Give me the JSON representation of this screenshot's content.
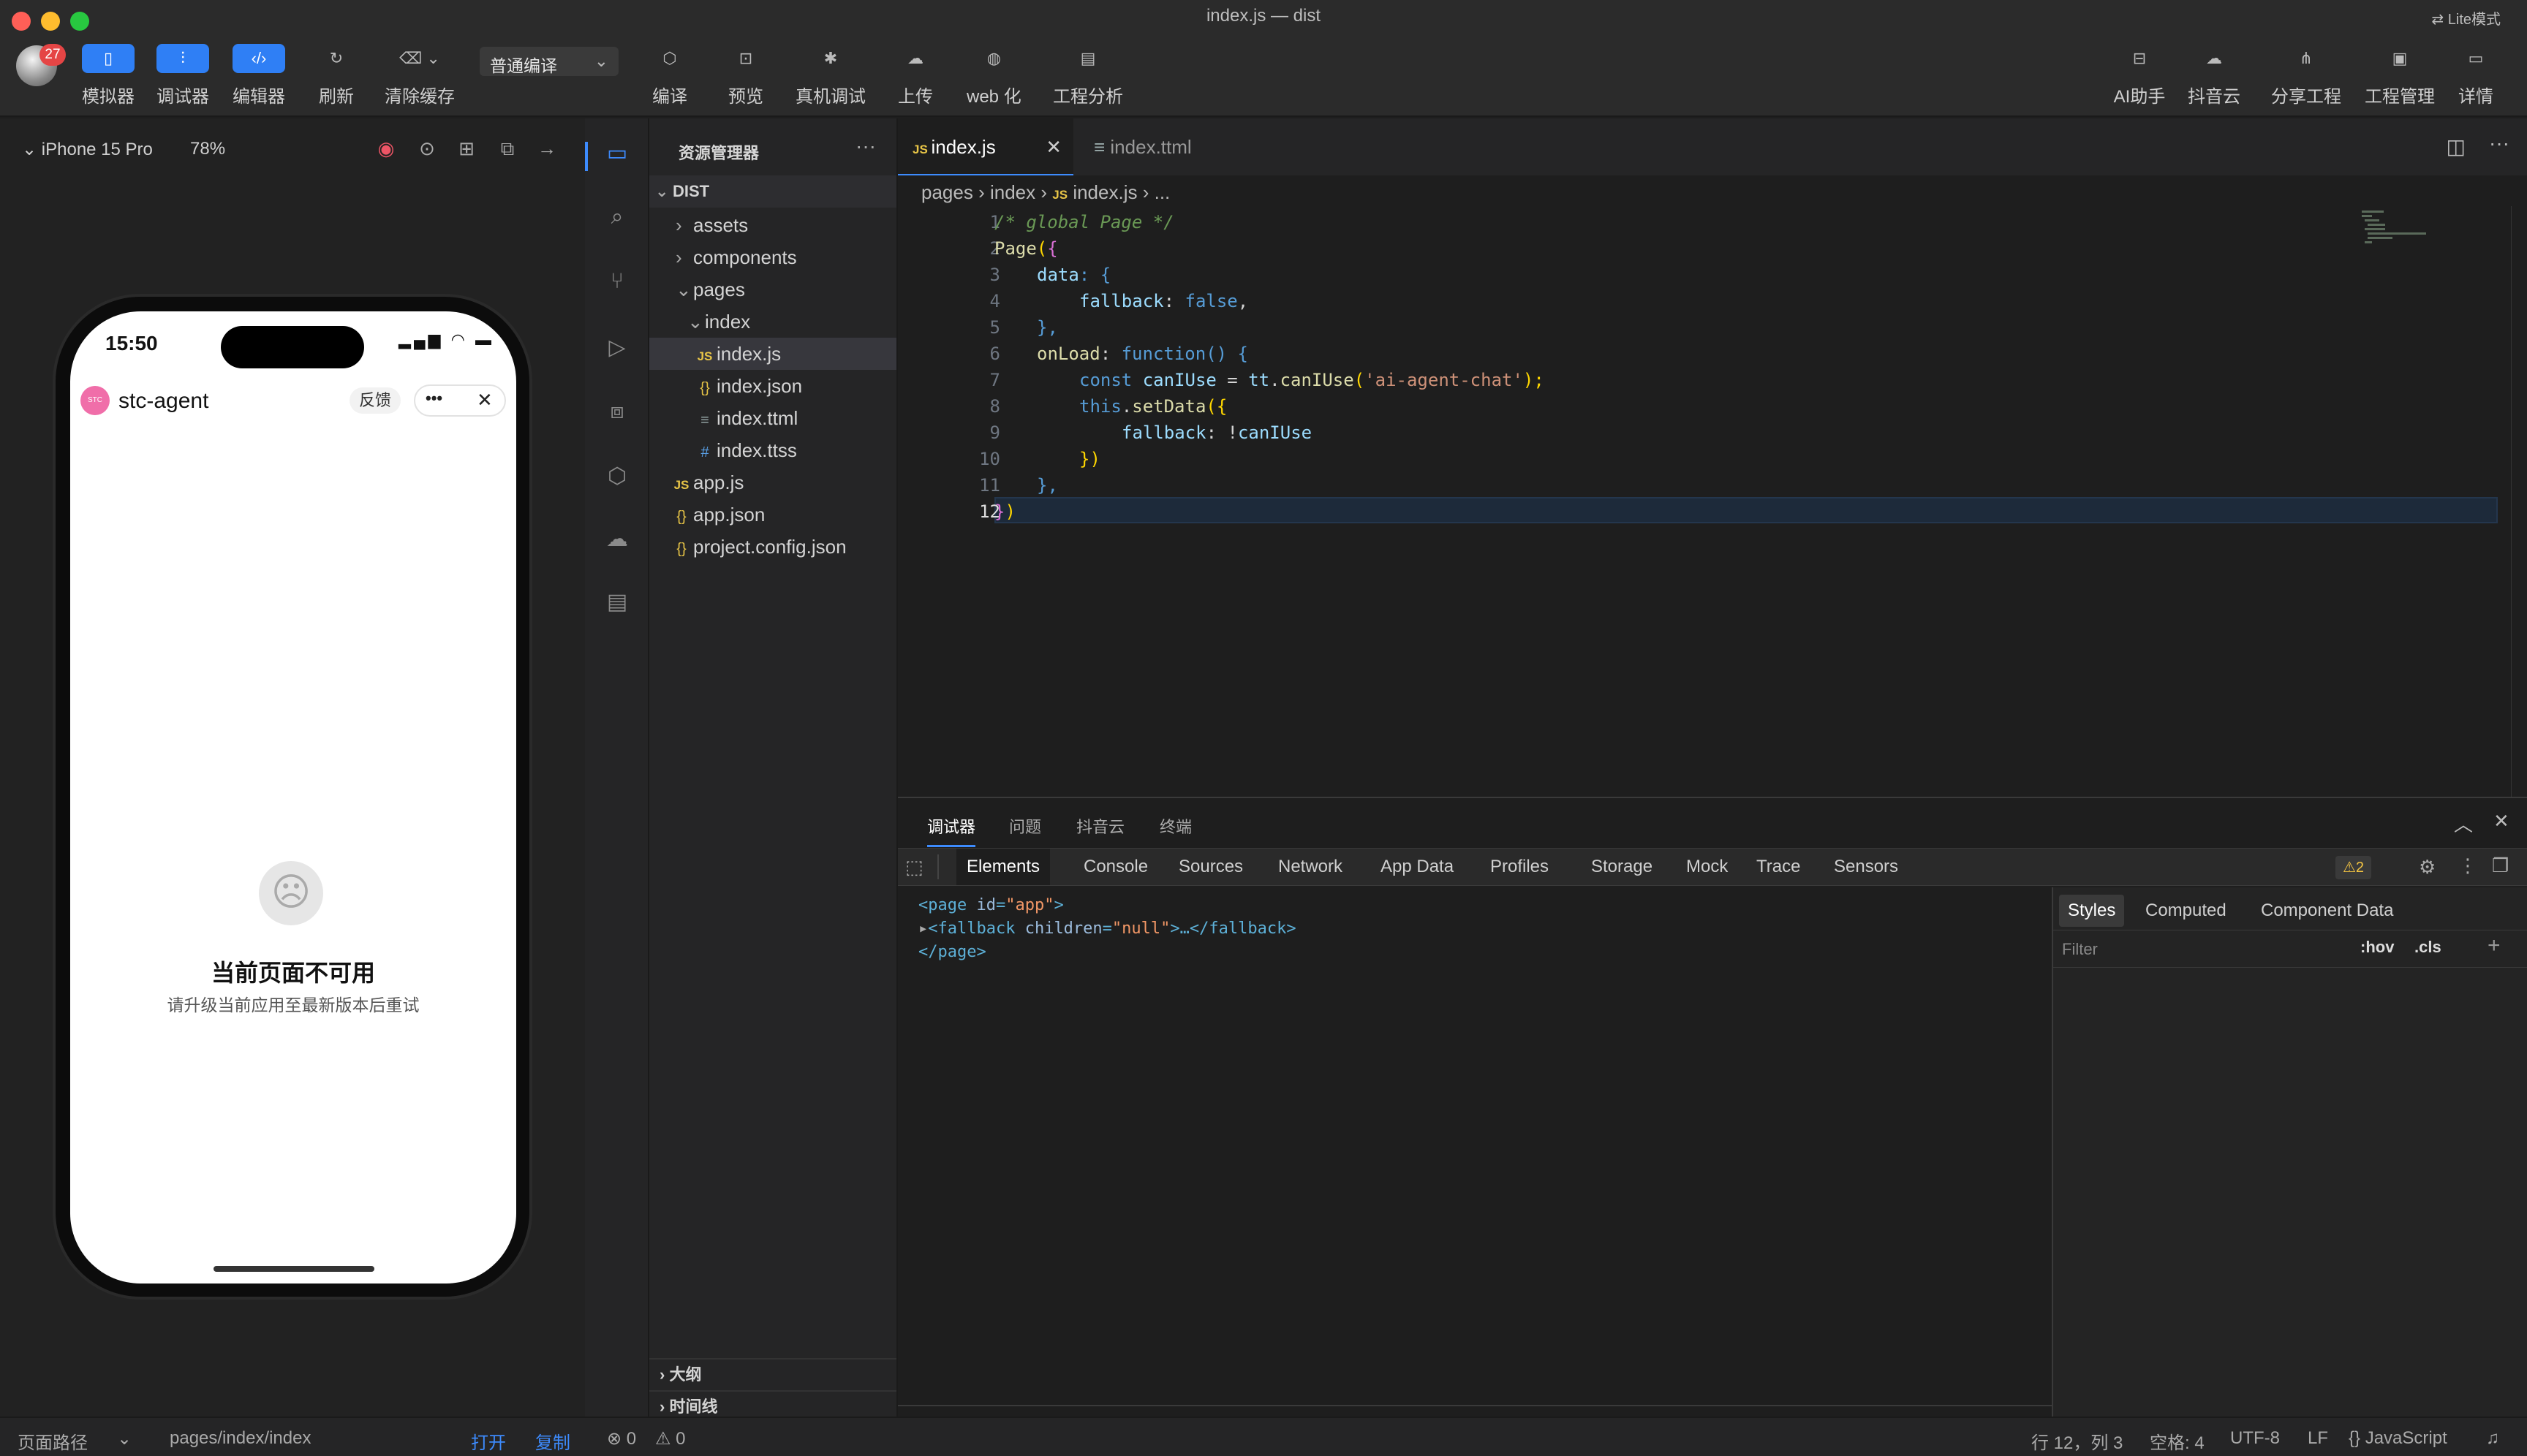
{
  "window": {
    "title": "index.js — dist",
    "lite_mode": "Lite模式"
  },
  "user": {
    "badge_count": "27"
  },
  "toolbar": {
    "simulator": "模拟器",
    "debugger": "调试器",
    "editor": "编辑器",
    "refresh": "刷新",
    "clear_cache": "清除缓存",
    "compile_mode": "普通编译",
    "compile": "编译",
    "preview": "预览",
    "real_device_debug": "真机调试",
    "upload": "上传",
    "web": "web 化",
    "project_analysis": "工程分析",
    "ai_assistant": "AI助手",
    "douyin_cloud": "抖音云",
    "share_project": "分享工程",
    "project_manage": "工程管理",
    "details": "详情"
  },
  "simulator": {
    "device": "iPhone 15 Pro",
    "zoom": "78%",
    "time": "15:50",
    "app_name": "stc-agent",
    "logo_text": "STC",
    "feedback": "反馈",
    "more": "•••",
    "close": "✕",
    "error_title": "当前页面不可用",
    "error_subtitle": "请升级当前应用至最新版本后重试"
  },
  "explorer": {
    "title": "资源管理器",
    "root": "DIST",
    "items": [
      {
        "label": "assets"
      },
      {
        "label": "components"
      },
      {
        "label": "pages"
      },
      {
        "label": "index"
      },
      {
        "label": "index.js"
      },
      {
        "label": "index.json"
      },
      {
        "label": "index.ttml"
      },
      {
        "label": "index.ttss"
      },
      {
        "label": "app.js"
      },
      {
        "label": "app.json"
      },
      {
        "label": "project.config.json"
      }
    ],
    "outline": "大纲",
    "timeline": "时间线"
  },
  "editor": {
    "tabs": [
      {
        "label": "index.js"
      },
      {
        "label": "index.ttml"
      }
    ],
    "breadcrumb": {
      "pages": "pages",
      "index": "index",
      "file": "index.js",
      "ellipsis": "..."
    },
    "line_numbers": [
      "1",
      "2",
      "3",
      "4",
      "5",
      "6",
      "7",
      "8",
      "9",
      "10",
      "11",
      "12"
    ],
    "code": {
      "l1": "/* global Page */",
      "l2_fn": "Page",
      "l2_paren": "(",
      "l2_brace": "{",
      "l3_prop": "data",
      "l3_rest": ": {",
      "l4_prop": "fallback",
      "l4_rest": ": ",
      "l4_val": "false",
      "l4_end": ",",
      "l5": "},",
      "l6_prop": "onLoad",
      "l6_colon": ": ",
      "l6_kw": "function",
      "l6_rest": "() {",
      "l7_kw": "const",
      "l7_var": " canIUse",
      "l7_eq": " = ",
      "l7_obj": "tt",
      "l7_dot": ".",
      "l7_fn": "canIUse",
      "l7_open": "(",
      "l7_str": "'ai-agent-chat'",
      "l7_close": ");",
      "l8_kw": "this",
      "l8_dot": ".",
      "l8_fn": "setData",
      "l8_open": "({",
      "l9_prop": "fallback",
      "l9_rest": ": !",
      "l9_var": "canIUse",
      "l10": "})",
      "l11": "},",
      "l12_brace": "}",
      "l12_paren": ")"
    }
  },
  "panel": {
    "tabs": [
      "调试器",
      "问题",
      "抖音云",
      "终端"
    ],
    "devtools_tabs": [
      "Elements",
      "Console",
      "Sources",
      "Network",
      "App Data",
      "Profiles",
      "Storage",
      "Mock",
      "Trace",
      "Sensors"
    ],
    "warnings": "⚠2",
    "dom": {
      "line1_open": "<page ",
      "line1_attr": "id",
      "line1_eq": "=",
      "line1_val": "\"app\"",
      "line1_close": ">",
      "line2_arrow": "▸",
      "line2_open": "<fallback ",
      "line2_attr": "children",
      "line2_eq": "=",
      "line2_val": "\"null\"",
      "line2_close": ">…</fallback>",
      "line3": "</page>"
    },
    "styles_tabs": [
      "Styles",
      "Computed",
      "Component Data"
    ],
    "filter_placeholder": "Filter",
    "hov": ":hov",
    "cls": ".cls"
  },
  "statusbar": {
    "page_path_label": "页面路径",
    "page_path": "pages/index/index",
    "open": "打开",
    "copy": "复制",
    "errors": "⊗ 0",
    "warnings": "⚠ 0",
    "position": "行 12，列 3",
    "spaces": "空格: 4",
    "encoding": "UTF-8",
    "eol": "LF",
    "language": "{} JavaScript"
  },
  "colors": {
    "accent": "#3d8bfd",
    "badge": "#e54545",
    "background": "#1e1e1e"
  }
}
